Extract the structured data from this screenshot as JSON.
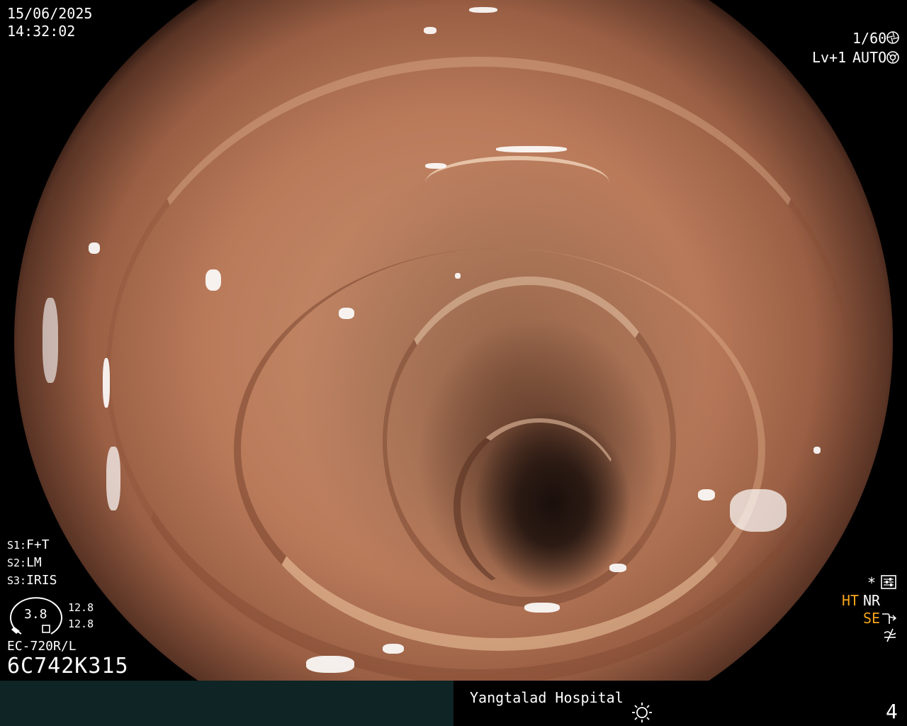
{
  "overlay": {
    "date": "15/06/2025",
    "time": "14:32:02",
    "shutter": "1/60",
    "level": "Lv+1",
    "exposure_mode": "AUTO",
    "s1_label": "S1:",
    "s1_value": "F+T",
    "s2_label": "S2:",
    "s2_value": "LM",
    "s3_label": "S3:",
    "s3_value": "IRIS",
    "gauge_value": "3.8",
    "gauge_reading_1": "12.8",
    "gauge_reading_2": "12.8",
    "scope_model": "EC-720R/L",
    "scope_serial": "6C742K315",
    "asterisk": "*",
    "ht_label": "HT",
    "nr_label": "NR",
    "se_label": "SE"
  },
  "bottom_bar": {
    "hospital": "Yangtalad Hospital",
    "image_number": "4"
  },
  "icons": {
    "shutter": "aperture-icon",
    "auto": "iris-icon",
    "menu": "settings-sliders-icon",
    "se": "enhancement-icon",
    "wave": "wave-icon",
    "light": "sun-icon"
  },
  "colors": {
    "status_orange": "#f6a31a",
    "bar_teal": "#0f2424"
  }
}
